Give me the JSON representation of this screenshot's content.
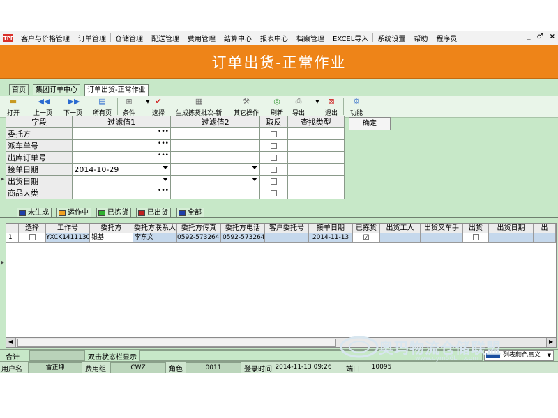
{
  "menu": {
    "app_icon": "TPF",
    "items": [
      "客户与价格管理",
      "订单管理",
      "仓储管理",
      "配送管理",
      "费用管理",
      "结算中心",
      "报表中心",
      "档案管理",
      "EXCEL导入",
      "系统设置",
      "帮助",
      "程序员"
    ],
    "window_controls": [
      "_",
      "♂",
      "×"
    ]
  },
  "title": "订单出货-正常作业",
  "tabs": [
    "首页",
    "集团订单中心",
    "订单出货-正常作业"
  ],
  "toolbar": {
    "items": [
      {
        "label": "打开",
        "icon": "folder-open-icon"
      },
      {
        "label": "上一页",
        "icon": "arrow-left-icon"
      },
      {
        "label": "下一页",
        "icon": "arrow-right-icon"
      },
      {
        "label": "所有页",
        "icon": "pages-icon"
      },
      {
        "label": "条件",
        "icon": "grid-icon"
      },
      {
        "label": "选择",
        "icon": "checkmark-icon"
      },
      {
        "label": "生成拣货批次-新",
        "icon": "batch-icon"
      },
      {
        "label": "其它操作",
        "icon": "tools-icon"
      },
      {
        "label": "刷新",
        "icon": "refresh-icon"
      },
      {
        "label": "导出",
        "icon": "export-icon"
      },
      {
        "label": "退出",
        "icon": "exit-icon"
      },
      {
        "label": "功能",
        "icon": "function-icon"
      }
    ]
  },
  "filter": {
    "headers": [
      "字段",
      "过滤值1",
      "过滤值2",
      "取反",
      "查找类型"
    ],
    "rows": [
      {
        "field": "委托方",
        "value1": "",
        "value2": ""
      },
      {
        "field": "派车单号",
        "value1": "",
        "value2": ""
      },
      {
        "field": "出库订单号",
        "value1": "",
        "value2": ""
      },
      {
        "field": "接单日期",
        "value1": "2014-10-29",
        "value2": ""
      },
      {
        "field": "出货日期",
        "value1": "",
        "value2": ""
      },
      {
        "field": "商品大类",
        "value1": "",
        "value2": ""
      }
    ],
    "confirm_label": "确定"
  },
  "status_tabs": [
    {
      "label": "未生成",
      "color": "#1f3fa8"
    },
    {
      "label": "运作中",
      "color": "#f0a020"
    },
    {
      "label": "已拣货",
      "color": "#30b030"
    },
    {
      "label": "已出货",
      "color": "#c02020"
    },
    {
      "label": "全部",
      "color": "#1f3fa8"
    }
  ],
  "grid": {
    "headers": [
      "",
      "选择",
      "工作号",
      "委托方",
      "委托方联系人",
      "委托方传真",
      "委托方电话",
      "客户委托号",
      "接单日期",
      "已拣货",
      "出货工人",
      "出货叉车手",
      "出货",
      "出货日期",
      "出"
    ],
    "rows": [
      {
        "index": "1",
        "job_no": "YXCK14111300",
        "client": "银基",
        "contact": "李东文",
        "fax": "0592-5732648",
        "phone": "0592-5732648",
        "client_ref": "",
        "order_date": "2014-11-13",
        "picked": true
      }
    ]
  },
  "status": {
    "total_label": "合计",
    "hint": "双击状态栏显示",
    "legend_label": "列表颜色意义"
  },
  "userbar": {
    "user_label": "用户名",
    "user_value": "雷正坤",
    "group_label": "费用组",
    "group_value": "CWZ",
    "role_label": "角色",
    "role_value": "0011",
    "login_label": "登录时间",
    "login_value": "2014-11-13 09:26",
    "port_label": "端口",
    "port_value": "10095"
  },
  "watermark": {
    "brand": "奥玛物流仓储联盟",
    "url": "www.oym56Lm.com"
  }
}
